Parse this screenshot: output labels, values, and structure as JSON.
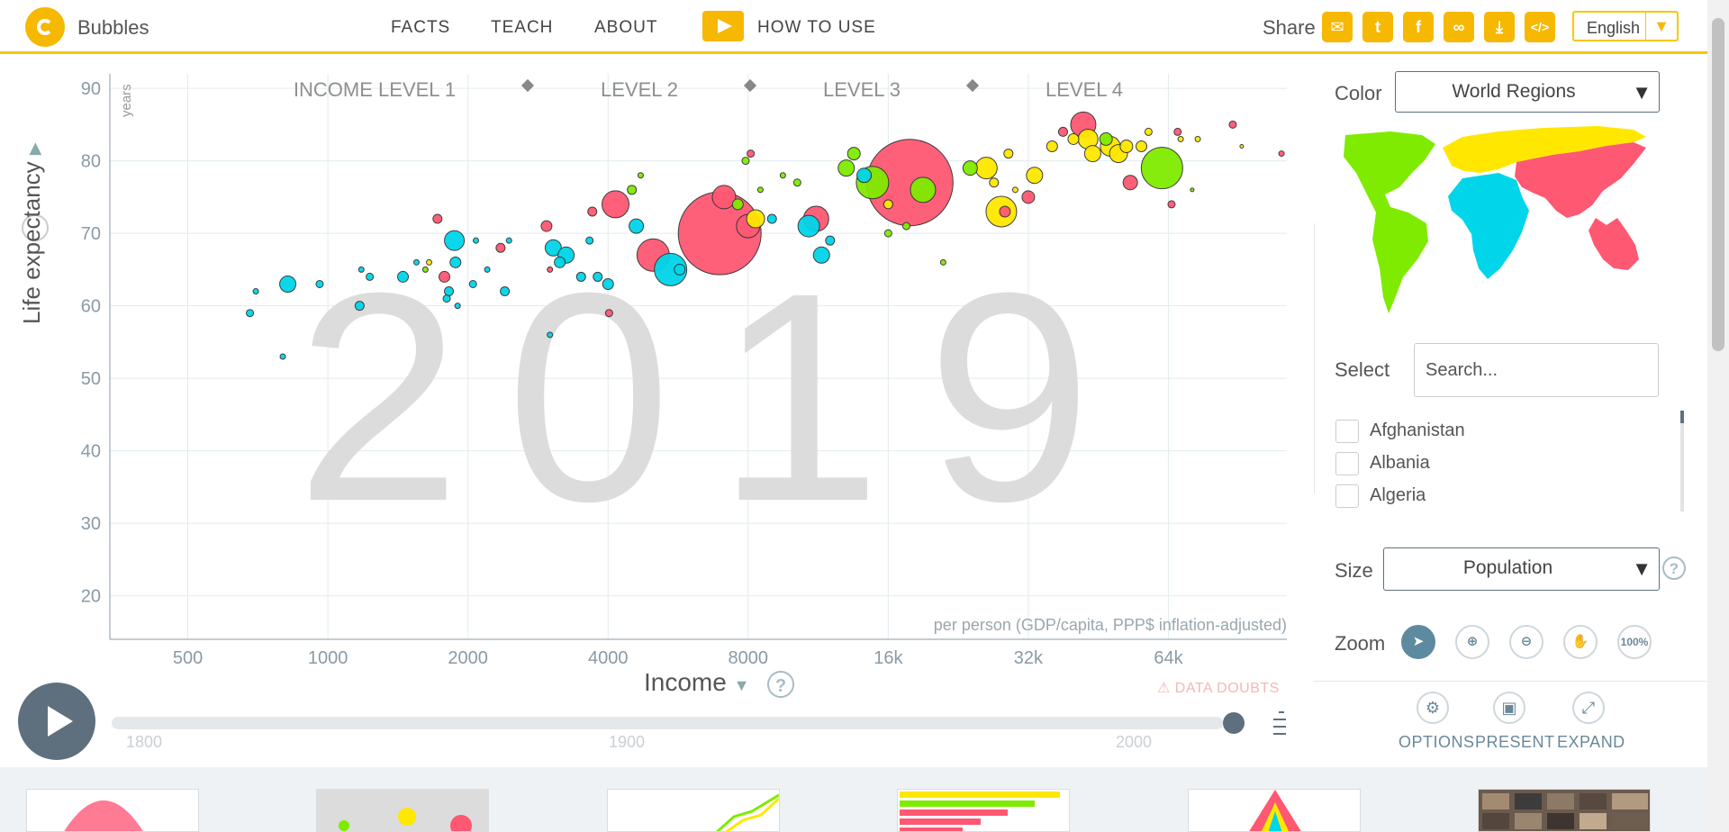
{
  "header": {
    "brand": "Bubbles",
    "nav": [
      "FACTS",
      "TEACH",
      "ABOUT"
    ],
    "how_to_use": "HOW TO USE",
    "share_label": "Share",
    "share_icons": [
      "mail-icon",
      "twitter-icon",
      "facebook-icon",
      "link-icon",
      "download-icon",
      "embed-code-icon"
    ],
    "language": "English"
  },
  "chart": {
    "xlabel": "Income",
    "ylabel": "Life expectancy",
    "yunits": "years",
    "xunits_note": "per person (GDP/capita, PPP$ inflation-adjusted)",
    "data_doubts": "DATA DOUBTS"
  },
  "chart_data": {
    "type": "scatter",
    "subtype": "bubble",
    "year": "2019",
    "x_scale": "log",
    "xlim": [
      340,
      115000
    ],
    "ylim": [
      14,
      92
    ],
    "x_ticks": [
      500,
      1000,
      2000,
      4000,
      8000,
      16000,
      32000,
      64000
    ],
    "x_tick_labels": [
      "500",
      "1000",
      "2000",
      "4000",
      "8000",
      "16k",
      "32k",
      "64k"
    ],
    "y_ticks": [
      20,
      30,
      40,
      50,
      60,
      70,
      80,
      90
    ],
    "income_levels": [
      "INCOME LEVEL 1",
      "LEVEL 2",
      "LEVEL 3",
      "LEVEL 4"
    ],
    "grid": true,
    "color_by": "World Regions",
    "size_by": "Population",
    "region_colors": {
      "africa": "#00d5e9",
      "americas": "#7feb00",
      "asia": "#ff5872",
      "europe": "#ffe700"
    },
    "bubbles": [
      {
        "x": 680,
        "y": 59,
        "r": 4,
        "region": "africa"
      },
      {
        "x": 700,
        "y": 62,
        "r": 3,
        "region": "africa"
      },
      {
        "x": 820,
        "y": 63,
        "r": 9,
        "region": "africa"
      },
      {
        "x": 800,
        "y": 53,
        "r": 3,
        "region": "africa"
      },
      {
        "x": 960,
        "y": 63,
        "r": 4,
        "region": "africa"
      },
      {
        "x": 1170,
        "y": 60,
        "r": 5,
        "region": "africa"
      },
      {
        "x": 1180,
        "y": 65,
        "r": 3,
        "region": "africa"
      },
      {
        "x": 1230,
        "y": 64,
        "r": 4,
        "region": "africa"
      },
      {
        "x": 1450,
        "y": 64,
        "r": 6,
        "region": "africa"
      },
      {
        "x": 1550,
        "y": 66,
        "r": 3,
        "region": "africa"
      },
      {
        "x": 1620,
        "y": 65,
        "r": 3,
        "region": "americas"
      },
      {
        "x": 1650,
        "y": 66,
        "r": 3,
        "region": "europe"
      },
      {
        "x": 1720,
        "y": 72,
        "r": 5,
        "region": "asia"
      },
      {
        "x": 1780,
        "y": 64,
        "r": 6,
        "region": "asia"
      },
      {
        "x": 1800,
        "y": 61,
        "r": 4,
        "region": "africa"
      },
      {
        "x": 1820,
        "y": 62,
        "r": 5,
        "region": "africa"
      },
      {
        "x": 1870,
        "y": 69,
        "r": 11,
        "region": "africa"
      },
      {
        "x": 1880,
        "y": 66,
        "r": 6,
        "region": "africa"
      },
      {
        "x": 1900,
        "y": 60,
        "r": 3,
        "region": "africa"
      },
      {
        "x": 2050,
        "y": 63,
        "r": 4,
        "region": "africa"
      },
      {
        "x": 2080,
        "y": 69,
        "r": 3,
        "region": "africa"
      },
      {
        "x": 2200,
        "y": 65,
        "r": 3,
        "region": "africa"
      },
      {
        "x": 2350,
        "y": 68,
        "r": 5,
        "region": "asia"
      },
      {
        "x": 2400,
        "y": 62,
        "r": 5,
        "region": "africa"
      },
      {
        "x": 2450,
        "y": 69,
        "r": 3,
        "region": "africa"
      },
      {
        "x": 2950,
        "y": 71,
        "r": 6,
        "region": "asia"
      },
      {
        "x": 3000,
        "y": 65,
        "r": 3,
        "region": "asia"
      },
      {
        "x": 3000,
        "y": 56,
        "r": 3,
        "region": "africa"
      },
      {
        "x": 3050,
        "y": 68,
        "r": 9,
        "region": "africa"
      },
      {
        "x": 3150,
        "y": 66,
        "r": 6,
        "region": "africa"
      },
      {
        "x": 3250,
        "y": 67,
        "r": 9,
        "region": "africa"
      },
      {
        "x": 3500,
        "y": 64,
        "r": 5,
        "region": "africa"
      },
      {
        "x": 3700,
        "y": 73,
        "r": 5,
        "region": "asia"
      },
      {
        "x": 3650,
        "y": 69,
        "r": 4,
        "region": "africa"
      },
      {
        "x": 3800,
        "y": 64,
        "r": 5,
        "region": "africa"
      },
      {
        "x": 4000,
        "y": 63,
        "r": 6,
        "region": "africa"
      },
      {
        "x": 4020,
        "y": 59,
        "r": 4,
        "region": "asia"
      },
      {
        "x": 4150,
        "y": 74,
        "r": 15,
        "region": "asia"
      },
      {
        "x": 4500,
        "y": 76,
        "r": 5,
        "region": "americas"
      },
      {
        "x": 4600,
        "y": 71,
        "r": 8,
        "region": "africa"
      },
      {
        "x": 4700,
        "y": 78,
        "r": 3,
        "region": "americas"
      },
      {
        "x": 5000,
        "y": 67,
        "r": 18,
        "region": "asia"
      },
      {
        "x": 5450,
        "y": 65,
        "r": 18,
        "region": "africa"
      },
      {
        "x": 5700,
        "y": 65,
        "r": 6,
        "region": "africa"
      },
      {
        "x": 6950,
        "y": 70,
        "r": 46,
        "region": "asia"
      },
      {
        "x": 7100,
        "y": 75,
        "r": 13,
        "region": "asia"
      },
      {
        "x": 7600,
        "y": 74,
        "r": 6,
        "region": "americas"
      },
      {
        "x": 8000,
        "y": 71,
        "r": 13,
        "region": "asia"
      },
      {
        "x": 8300,
        "y": 72,
        "r": 10,
        "region": "europe"
      },
      {
        "x": 7900,
        "y": 80,
        "r": 4,
        "region": "americas"
      },
      {
        "x": 8100,
        "y": 81,
        "r": 4,
        "region": "asia"
      },
      {
        "x": 8500,
        "y": 76,
        "r": 3,
        "region": "americas"
      },
      {
        "x": 9000,
        "y": 72,
        "r": 5,
        "region": "africa"
      },
      {
        "x": 9500,
        "y": 78,
        "r": 3,
        "region": "americas"
      },
      {
        "x": 10200,
        "y": 77,
        "r": 4,
        "region": "americas"
      },
      {
        "x": 11200,
        "y": 72,
        "r": 14,
        "region": "asia"
      },
      {
        "x": 10800,
        "y": 71,
        "r": 12,
        "region": "africa"
      },
      {
        "x": 12000,
        "y": 69,
        "r": 5,
        "region": "africa"
      },
      {
        "x": 11500,
        "y": 67,
        "r": 9,
        "region": "africa"
      },
      {
        "x": 13000,
        "y": 79,
        "r": 9,
        "region": "americas"
      },
      {
        "x": 13500,
        "y": 81,
        "r": 7,
        "region": "americas"
      },
      {
        "x": 14200,
        "y": 78,
        "r": 8,
        "region": "africa"
      },
      {
        "x": 14800,
        "y": 77,
        "r": 18,
        "region": "americas"
      },
      {
        "x": 16000,
        "y": 74,
        "r": 5,
        "region": "europe"
      },
      {
        "x": 17800,
        "y": 77,
        "r": 48,
        "region": "asia"
      },
      {
        "x": 19000,
        "y": 76,
        "r": 14,
        "region": "americas"
      },
      {
        "x": 16000,
        "y": 70,
        "r": 4,
        "region": "americas"
      },
      {
        "x": 17500,
        "y": 71,
        "r": 4,
        "region": "americas"
      },
      {
        "x": 21000,
        "y": 66,
        "r": 3,
        "region": "americas"
      },
      {
        "x": 24000,
        "y": 79,
        "r": 8,
        "region": "americas"
      },
      {
        "x": 26000,
        "y": 79,
        "r": 12,
        "region": "europe"
      },
      {
        "x": 27000,
        "y": 77,
        "r": 5,
        "region": "europe"
      },
      {
        "x": 28000,
        "y": 73,
        "r": 17,
        "region": "europe"
      },
      {
        "x": 28500,
        "y": 73,
        "r": 6,
        "region": "asia"
      },
      {
        "x": 29000,
        "y": 81,
        "r": 5,
        "region": "europe"
      },
      {
        "x": 30000,
        "y": 76,
        "r": 3,
        "region": "europe"
      },
      {
        "x": 32000,
        "y": 75,
        "r": 7,
        "region": "asia"
      },
      {
        "x": 33000,
        "y": 78,
        "r": 9,
        "region": "europe"
      },
      {
        "x": 36000,
        "y": 82,
        "r": 6,
        "region": "europe"
      },
      {
        "x": 38000,
        "y": 84,
        "r": 5,
        "region": "asia"
      },
      {
        "x": 40000,
        "y": 83,
        "r": 6,
        "region": "europe"
      },
      {
        "x": 42000,
        "y": 85,
        "r": 14,
        "region": "asia"
      },
      {
        "x": 43000,
        "y": 83,
        "r": 11,
        "region": "europe"
      },
      {
        "x": 44000,
        "y": 81,
        "r": 9,
        "region": "europe"
      },
      {
        "x": 47000,
        "y": 83,
        "r": 7,
        "region": "americas"
      },
      {
        "x": 48000,
        "y": 82,
        "r": 11,
        "region": "europe"
      },
      {
        "x": 50000,
        "y": 81,
        "r": 10,
        "region": "europe"
      },
      {
        "x": 52000,
        "y": 82,
        "r": 7,
        "region": "europe"
      },
      {
        "x": 53000,
        "y": 77,
        "r": 8,
        "region": "asia"
      },
      {
        "x": 56000,
        "y": 82,
        "r": 6,
        "region": "europe"
      },
      {
        "x": 58000,
        "y": 84,
        "r": 4,
        "region": "europe"
      },
      {
        "x": 62000,
        "y": 79,
        "r": 23,
        "region": "americas"
      },
      {
        "x": 65000,
        "y": 74,
        "r": 4,
        "region": "asia"
      },
      {
        "x": 67000,
        "y": 84,
        "r": 4,
        "region": "asia"
      },
      {
        "x": 68000,
        "y": 83,
        "r": 3,
        "region": "europe"
      },
      {
        "x": 72000,
        "y": 76,
        "r": 2,
        "region": "americas"
      },
      {
        "x": 74000,
        "y": 83,
        "r": 3,
        "region": "europe"
      },
      {
        "x": 88000,
        "y": 85,
        "r": 4,
        "region": "asia"
      },
      {
        "x": 92000,
        "y": 82,
        "r": 2,
        "region": "europe"
      },
      {
        "x": 112000,
        "y": 81,
        "r": 3,
        "region": "asia"
      }
    ]
  },
  "timeline": {
    "ticks": [
      "1800",
      "1900",
      "2000"
    ],
    "position": 1.0
  },
  "panel": {
    "color_label": "Color",
    "color_value": "World Regions",
    "select_label": "Select",
    "search_placeholder": "Search...",
    "countries": [
      "Afghanistan",
      "Albania",
      "Algeria"
    ],
    "size_label": "Size",
    "size_value": "Population",
    "zoom_label": "Zoom",
    "zoom_reset_label": "100%",
    "tools": [
      "OPTIONS",
      "PRESENT",
      "EXPAND"
    ]
  }
}
